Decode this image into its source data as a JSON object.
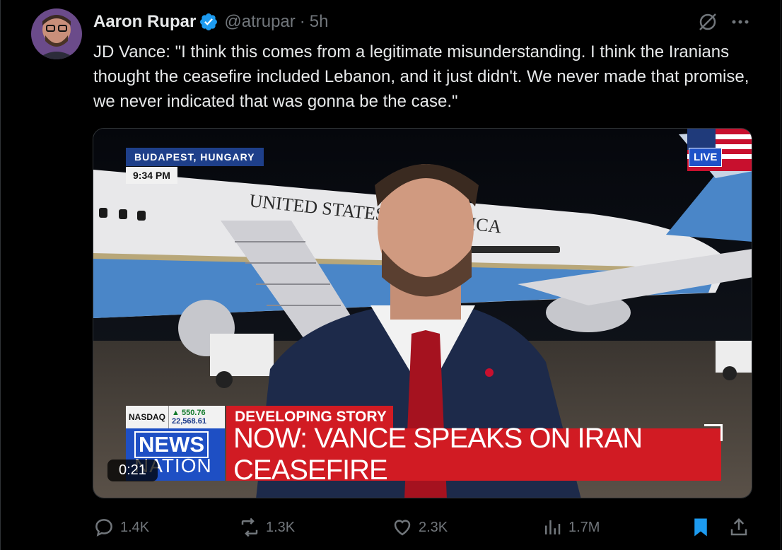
{
  "author": {
    "name": "Aaron Rupar",
    "handle": "@atrupar",
    "separator": "·",
    "time": "5h",
    "verified_color": "#1d9bf0"
  },
  "tweet": {
    "text": "JD Vance: \"I think this comes from a legitimate misunderstanding. I think the Iranians thought the ceasefire included Lebanon, and it just didn't. We never made that promise, we never indicated that was gonna be the case.\""
  },
  "video": {
    "location": "BUDAPEST, HUNGARY",
    "clock": "9:34 PM",
    "live": "LIVE",
    "ticker": {
      "name": "NASDAQ",
      "change": "▲ 550.76",
      "index": "22,568.61"
    },
    "developing": "DEVELOPING STORY",
    "logo_line1": "NEWS",
    "logo_line2": "NATION",
    "headline": "NOW: VANCE SPEAKS ON IRAN CEASEFIRE",
    "duration": "0:21",
    "plane_text": "UNITED STATES OF AMERICA"
  },
  "actions": {
    "replies": "1.4K",
    "reposts": "1.3K",
    "likes": "2.3K",
    "views": "1.7M"
  },
  "colors": {
    "accent": "#1d9bf0",
    "muted": "#71767b",
    "news_red": "#d11b23",
    "news_blue": "#1e4fc4"
  }
}
